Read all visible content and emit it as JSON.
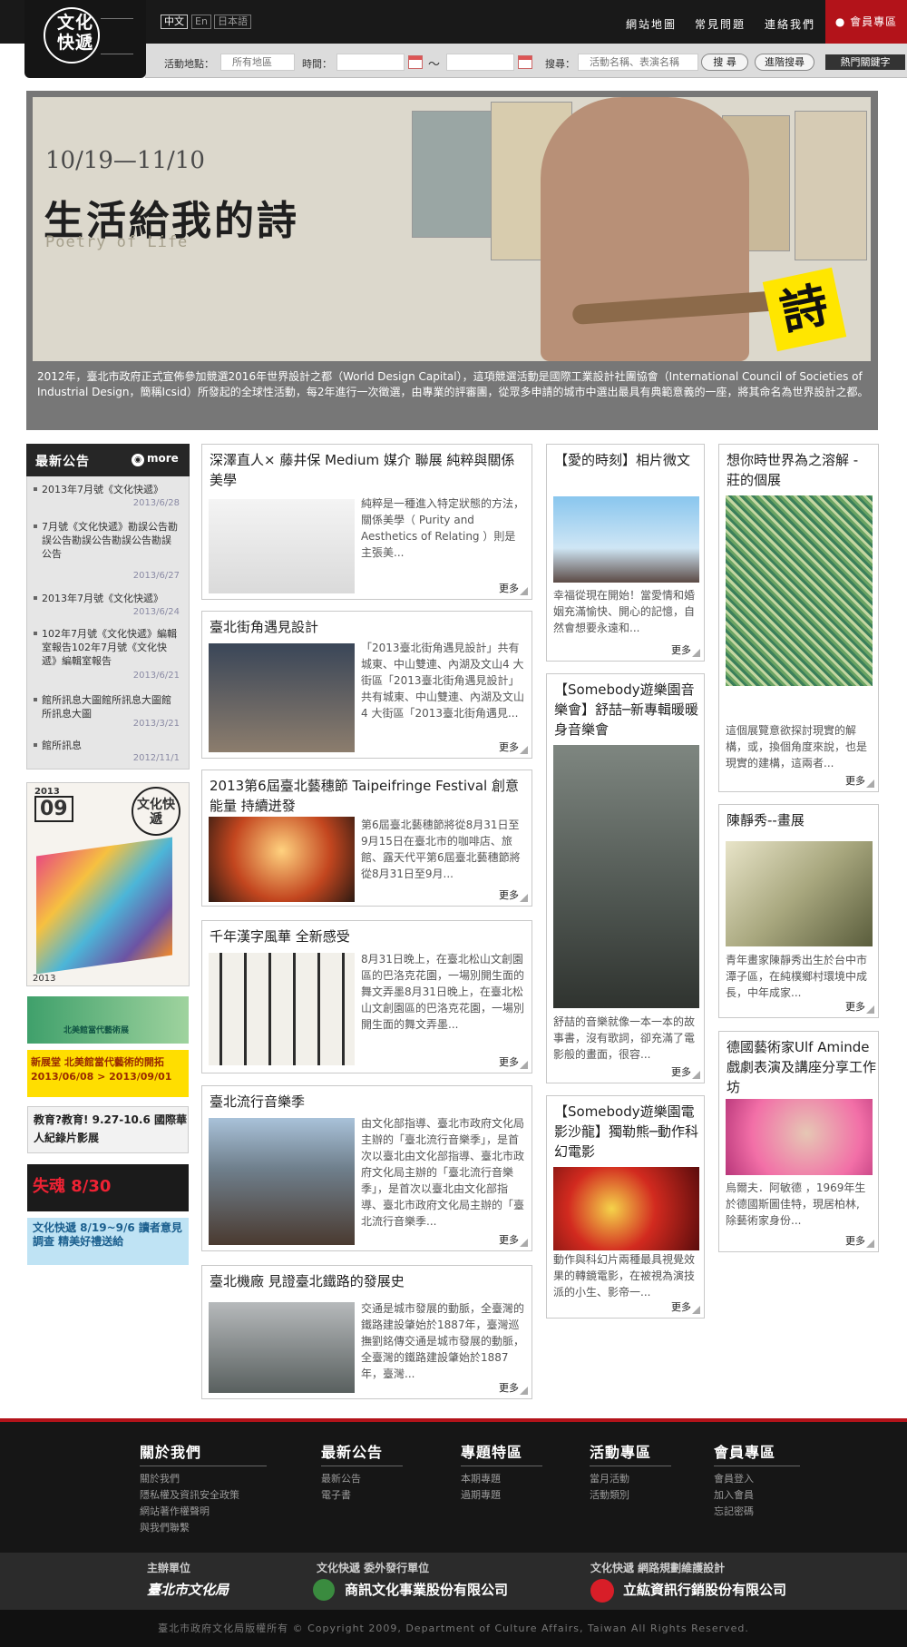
{
  "site": {
    "logo_text": "文化快遞"
  },
  "header": {
    "langs": [
      "中文",
      "En",
      "日本語"
    ],
    "nav": [
      "網站地圖",
      "常見問題",
      "連絡我們"
    ],
    "member": "會員專區"
  },
  "search": {
    "location_label": "活動地點：",
    "location_value": "所有地區",
    "time_label": "時間：",
    "tilde": "～",
    "keyword_label": "搜尋：",
    "keyword_placeholder": "活動名稱、表演名稱",
    "search_btn": "搜 尋",
    "advanced_btn": "進階搜尋",
    "hot_btn": "熱門關鍵字"
  },
  "banner": {
    "date": "10/19—11/10",
    "title": "生活給我的詩",
    "subtitle": "Poetry of Life",
    "badge": "詩",
    "caption": "2012年，臺北市政府正式宣佈參加競選2016年世界設計之都（World Design Capital），這項競選活動是國際工業設計社團協會（International Council of Societies of Industrial Design，簡稱Icsid）所發起的全球性活動，每2年進行一次徵選，由專業的評審團，從眾多申請的城市中選出最具有典範意義的一座，將其命名為世界設計之都。"
  },
  "news": {
    "title": "最新公告",
    "more": "more",
    "items": [
      {
        "text": "2013年7月號《文化快遞》",
        "date": "2013/6/28"
      },
      {
        "text": "7月號《文化快遞》勘誤公告勘誤公告勘誤公告勘誤公告勘誤公告",
        "date": "2013/6/27"
      },
      {
        "text": "2013年7月號《文化快遞》",
        "date": "2013/6/24"
      },
      {
        "text": "102年7月號《文化快遞》編輯室報告102年7月號《文化快遞》編輯室報告",
        "date": "2013/6/21"
      },
      {
        "text": "館所訊息大圖館所訊息大圖館所訊息大圖",
        "date": "2013/3/21"
      },
      {
        "text": "館所訊息",
        "date": "2012/11/1"
      }
    ]
  },
  "magazine": {
    "issue": "09",
    "year": "2013",
    "label": "文化快遞"
  },
  "ads": [
    "北美館當代藝術展",
    "新展堂 北美館當代藝術的開拓 2013/06/08 > 2013/09/01",
    "教育?教育! 9.27-10.6 國際華人紀錄片影展",
    "失魂 8/30",
    "文化快遞 8/19~9/6 讀者意見調查 精美好禮送給"
  ],
  "more_label": "更多",
  "col1": [
    {
      "title": "深澤直人× 藤井保 Medium 媒介 聯展 純粹與關係美學",
      "desc": "純粹是一種進入特定狀態的方法，關係美學（ Purity and Aesthetics of Relating ）則是主張美..."
    },
    {
      "title": "臺北街角遇見設計",
      "desc": "「2013臺北街角遇見設計」共有城東、中山雙連、內湖及文山4 大街區「2013臺北街角遇見設計」共有城東、中山雙連、內湖及文山4 大街區「2013臺北街角遇見..."
    },
    {
      "title": "2013第6屆臺北藝穗節 Taipeifringe Festival 創意能量 持續迸發",
      "desc": "第6屆臺北藝穗節將從8月31日至9月15日在臺北市的咖啡店、旅館、露天代平第6屆臺北藝穗節將從8月31日至9月..."
    },
    {
      "title": "千年漢字風華 全新感受",
      "desc": "8月31日晚上，在臺北松山文創園區的巴洛克花園，一場別開生面的舞文弄墨8月31日晚上，在臺北松山文創園區的巴洛克花園，一場別開生面的舞文弄墨..."
    },
    {
      "title": "臺北流行音樂季",
      "desc": "由文化部指導、臺北市政府文化局主辦的「臺北流行音樂季」，是首次以臺北由文化部指導、臺北市政府文化局主辦的「臺北流行音樂季」，是首次以臺北由文化部指導、臺北市政府文化局主辦的「臺北流行音樂季..."
    },
    {
      "title": "臺北機廠 見證臺北鐵路的發展史",
      "desc": "交通是城市發展的動脈，全臺灣的鐵路建設肇始於1887年，臺灣巡撫劉銘傳交通是城市發展的動脈，全臺灣的鐵路建設肇始於1887年，臺灣..."
    }
  ],
  "col2": [
    {
      "title": "【愛的時刻】相片微文",
      "desc": "幸福從現在開始！當愛情和婚姻充滿愉快、開心的記憶，自然會想要永遠和..."
    },
    {
      "title": "【Somebody遊樂園音樂會】舒喆─新專輯暖暖身音樂會",
      "desc": "舒喆的音樂就像一本一本的故事書，沒有歌詞，卻充滿了電影般的畫面，很容..."
    },
    {
      "title": "【Somebody遊樂園電影沙龍】獨勒熊─動作科幻電影",
      "desc": "動作與科幻片兩種最具視覺效果的轉鏡電影，在被視為演技派的小生、影帝一..."
    }
  ],
  "col3": [
    {
      "title": "想你時世界為之溶解 - 莊的個展",
      "desc": "這個展覽意欲探討現實的解構，或，換個角度來說，也是現實的建構，這兩者..."
    },
    {
      "title": "陳靜秀--畫展",
      "desc": "青年畫家陳靜秀出生於台中市潭子區，在純樸鄉村環境中成長，中年成家..."
    },
    {
      "title": "德國藝術家Ulf Aminde戲劇表演及講座分享工作坊",
      "desc": "烏爾夫．阿敏德 ，1969年生於德國斯圖佳特，現居柏林, 除藝術家身份..."
    }
  ],
  "footer": {
    "cols": [
      {
        "title": "關於我們",
        "links": [
          "關於我們",
          "隱私權及資訊安全政策",
          "網站著作權聲明",
          "與我們聯繫"
        ]
      },
      {
        "title": "最新公告",
        "links": [
          "最新公告",
          "電子書"
        ]
      },
      {
        "title": "專題特區",
        "links": [
          "本期專題",
          "過期專題"
        ]
      },
      {
        "title": "活動專區",
        "links": [
          "當月活動",
          "活動類別"
        ]
      },
      {
        "title": "會員專區",
        "links": [
          "會員登入",
          "加入會員",
          "忘記密碼"
        ]
      }
    ]
  },
  "sponsors": [
    {
      "label": "主辦單位",
      "value": "臺北市文化局"
    },
    {
      "label": "文化快遞 委外發行單位",
      "value": "商訊文化事業股份有限公司"
    },
    {
      "label": "文化快遞 網路規劃維護設計",
      "value": "立紘資訊行銷股份有限公司"
    }
  ],
  "copyright": "臺北市政府文化局版權所有 © Copyright 2009, Department of Culture Affairs, Taiwan All Rights Reserved."
}
